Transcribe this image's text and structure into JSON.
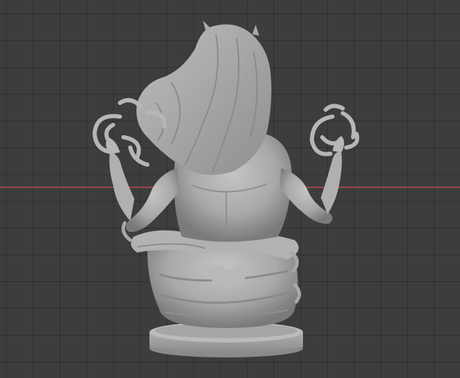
{
  "viewport": {
    "background_color": "#3d3d3d",
    "grid_line_color": "#333333",
    "x_axis_color": "#b3474f"
  },
  "model": {
    "icon": "sculpted-bust",
    "color": "#a8a8a8"
  }
}
